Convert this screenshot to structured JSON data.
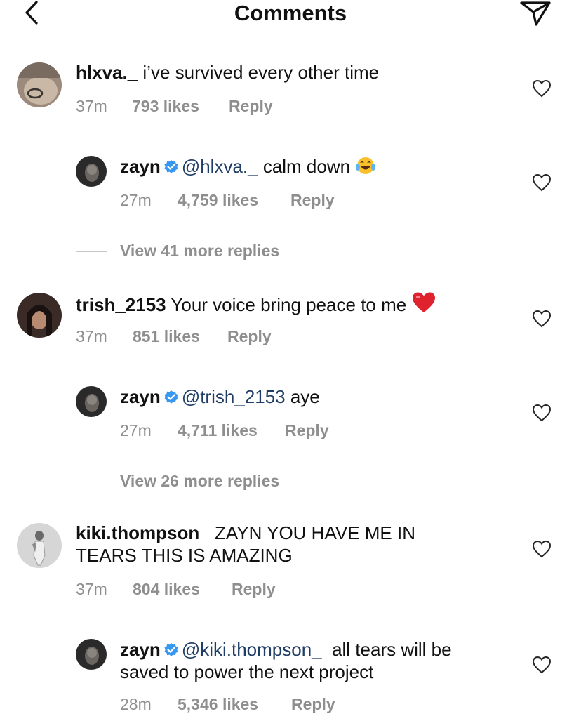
{
  "header": {
    "title": "Comments"
  },
  "comments": [
    {
      "username": "hlxva._",
      "text": "i’ve survived every other time",
      "time": "37m",
      "likes": "793 likes",
      "reply_label": "Reply",
      "replies": [
        {
          "username": "zayn",
          "mention": "@hlxva._",
          "text": " calm down ",
          "time": "27m",
          "likes": "4,759 likes",
          "reply_label": "Reply"
        }
      ],
      "view_more": "View 41 more replies"
    },
    {
      "username": "trish_2153",
      "text": "Your voice bring peace to me ",
      "time": "37m",
      "likes": "851 likes",
      "reply_label": "Reply",
      "replies": [
        {
          "username": "zayn",
          "mention": "@trish_2153",
          "text": " aye",
          "time": "27m",
          "likes": "4,711 likes",
          "reply_label": "Reply"
        }
      ],
      "view_more": "View 26 more replies"
    },
    {
      "username": "kiki.thompson_",
      "text": "ZAYN YOU HAVE ME IN",
      "text_line2": "TEARS THIS IS AMAZING",
      "time": "37m",
      "likes": "804 likes",
      "reply_label": "Reply",
      "replies": [
        {
          "username": "zayn",
          "mention": "@kiki.thompson_",
          "text": "  all tears will be",
          "text_line2": "saved to power the next project",
          "time": "28m",
          "likes": "5,346 likes",
          "reply_label": "Reply"
        }
      ]
    }
  ],
  "colors": {
    "verified": "#3897f0",
    "mention": "#1f3d66",
    "meta": "#8e8e8e",
    "heart_emoji": "#e0222e"
  },
  "icons": {
    "back": "chevron-left-icon",
    "send": "paper-plane-icon",
    "like": "heart-outline-icon",
    "verified": "verified-badge-icon"
  }
}
